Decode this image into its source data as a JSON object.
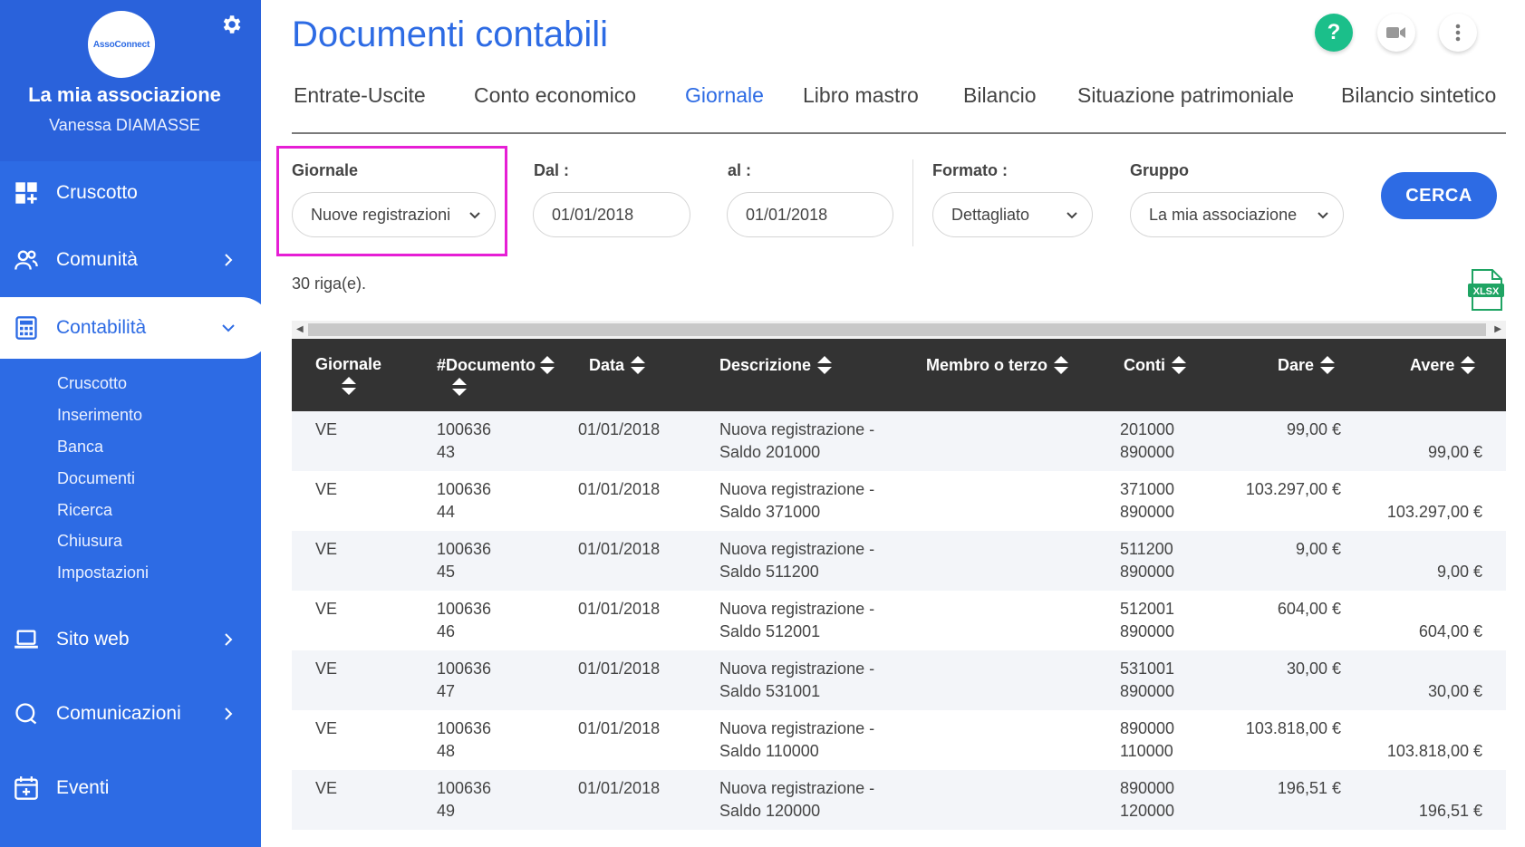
{
  "sidebar": {
    "logo_text": "AssoConnect",
    "org_name": "La mia associazione",
    "user_name": "Vanessa DIAMASSE",
    "items": [
      {
        "label": "Cruscotto",
        "icon": "dashboard-icon"
      },
      {
        "label": "Comunità",
        "icon": "users-icon"
      },
      {
        "label": "Contabilità",
        "icon": "calculator-icon"
      },
      {
        "label": "Sito web",
        "icon": "laptop-icon"
      },
      {
        "label": "Comunicazioni",
        "icon": "chat-icon"
      },
      {
        "label": "Eventi",
        "icon": "calendar-icon"
      }
    ],
    "sub_items": [
      "Cruscotto",
      "Inserimento",
      "Banca",
      "Documenti",
      "Ricerca",
      "Chiusura",
      "Impostazioni"
    ]
  },
  "header": {
    "title": "Documenti contabili",
    "help_label": "?"
  },
  "tabs": [
    "Entrate-Uscite",
    "Conto economico",
    "Giornale",
    "Libro mastro",
    "Bilancio",
    "Situazione patrimoniale",
    "Bilancio sintetico"
  ],
  "filters": {
    "giornale_label": "Giornale",
    "giornale_value": "Nuove registrazioni",
    "dal_label": "Dal :",
    "dal_value": "01/01/2018",
    "al_label": "al :",
    "al_value": "01/01/2018",
    "formato_label": "Formato :",
    "formato_value": "Dettagliato",
    "gruppo_label": "Gruppo",
    "gruppo_value": "La mia associazione",
    "search_button": "CERCA"
  },
  "row_count": "30 riga(e).",
  "xlsx_label": "XLSX",
  "table": {
    "headers": [
      "Giornale",
      "#Documento",
      "Data",
      "Descrizione",
      "Membro o terzo",
      "Conti",
      "Dare",
      "Avere"
    ],
    "rows": [
      {
        "giornale": "VE",
        "doc1": "100636",
        "doc2": "43",
        "data": "01/01/2018",
        "desc1": "Nuova registrazione -",
        "desc2": "Saldo 201000",
        "conto1": "201000",
        "conto2": "890000",
        "dare": "99,00 €",
        "avere": "99,00 €"
      },
      {
        "giornale": "VE",
        "doc1": "100636",
        "doc2": "44",
        "data": "01/01/2018",
        "desc1": "Nuova registrazione -",
        "desc2": "Saldo 371000",
        "conto1": "371000",
        "conto2": "890000",
        "dare": "103.297,00 €",
        "avere": "103.297,00 €"
      },
      {
        "giornale": "VE",
        "doc1": "100636",
        "doc2": "45",
        "data": "01/01/2018",
        "desc1": "Nuova registrazione -",
        "desc2": "Saldo 511200",
        "conto1": "511200",
        "conto2": "890000",
        "dare": "9,00 €",
        "avere": "9,00 €"
      },
      {
        "giornale": "VE",
        "doc1": "100636",
        "doc2": "46",
        "data": "01/01/2018",
        "desc1": "Nuova registrazione -",
        "desc2": "Saldo 512001",
        "conto1": "512001",
        "conto2": "890000",
        "dare": "604,00 €",
        "avere": "604,00 €"
      },
      {
        "giornale": "VE",
        "doc1": "100636",
        "doc2": "47",
        "data": "01/01/2018",
        "desc1": "Nuova registrazione -",
        "desc2": "Saldo 531001",
        "conto1": "531001",
        "conto2": "890000",
        "dare": "30,00 €",
        "avere": "30,00 €"
      },
      {
        "giornale": "VE",
        "doc1": "100636",
        "doc2": "48",
        "data": "01/01/2018",
        "desc1": "Nuova registrazione -",
        "desc2": "Saldo 110000",
        "conto1": "890000",
        "conto2": "110000",
        "dare": "103.818,00 €",
        "avere": "103.818,00 €"
      },
      {
        "giornale": "VE",
        "doc1": "100636",
        "doc2": "49",
        "data": "01/01/2018",
        "desc1": "Nuova registrazione -",
        "desc2": "Saldo 120000",
        "conto1": "890000",
        "conto2": "120000",
        "dare": "196,51 €",
        "avere": "196,51 €"
      }
    ]
  },
  "colors": {
    "sidebar": "#2d6be4",
    "accent": "#2d6be4",
    "highlight": "#e61fd5",
    "help": "#1bbf8a",
    "table_header": "#333333"
  }
}
